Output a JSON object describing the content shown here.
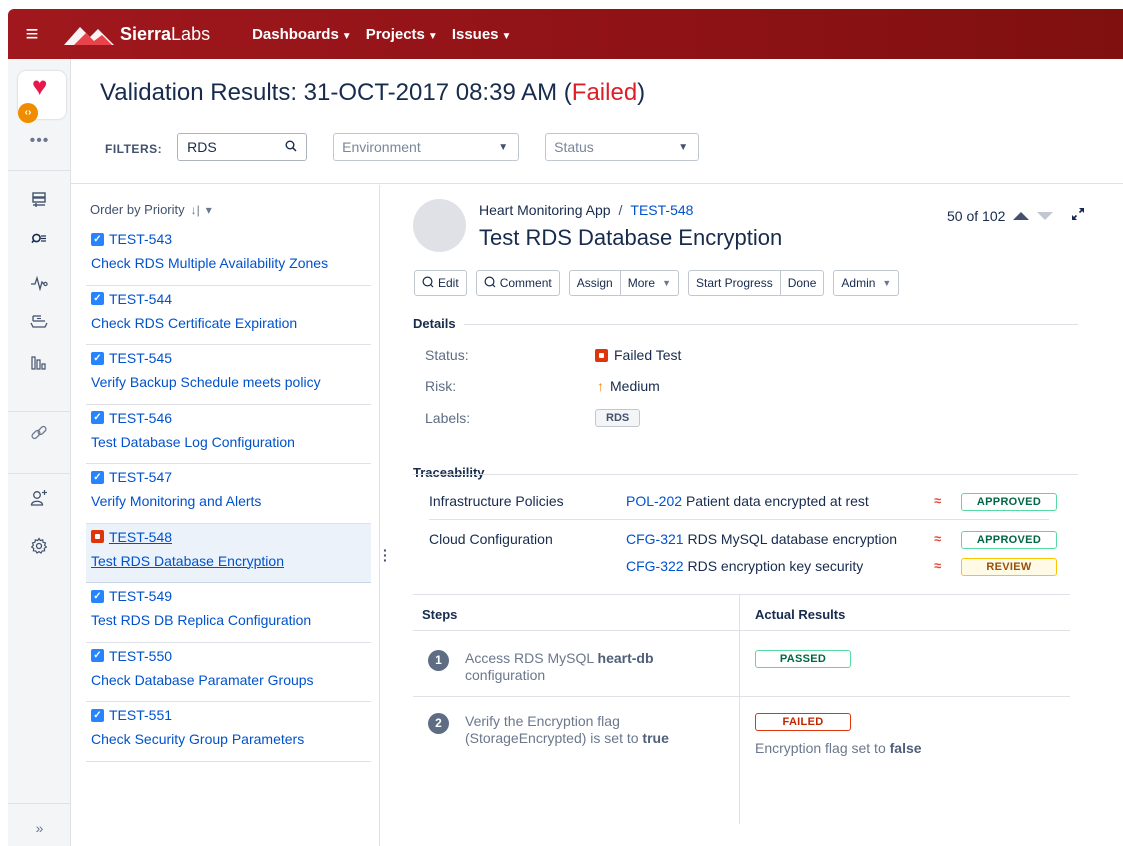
{
  "topbar": {
    "brand_bold": "Sierra",
    "brand_light": "Labs",
    "nav": [
      "Dashboards",
      "Projects",
      "Issues"
    ]
  },
  "rail": {
    "app_icon": "heart-icon",
    "more": "•••",
    "expand": "»"
  },
  "header": {
    "title_prefix": "Validation Results: 31-OCT-2017 08:39 AM (",
    "title_status": "Failed",
    "title_suffix": ")",
    "status_color": "#de1f28",
    "filters_label": "FILTERS:",
    "search_value": "RDS",
    "environment_placeholder": "Environment",
    "status_placeholder": "Status"
  },
  "list": {
    "order_label": "Order by Priority",
    "items": [
      {
        "key": "TEST-543",
        "summary": "Check RDS Multiple Availability Zones",
        "state": "pass"
      },
      {
        "key": "TEST-544",
        "summary": "Check RDS Certificate Expiration",
        "state": "pass"
      },
      {
        "key": "TEST-545",
        "summary": "Verify Backup Schedule meets policy",
        "state": "pass"
      },
      {
        "key": "TEST-546",
        "summary": "Test Database Log Configuration",
        "state": "pass"
      },
      {
        "key": "TEST-547",
        "summary": "Verify Monitoring and Alerts",
        "state": "pass"
      },
      {
        "key": "TEST-548",
        "summary": "Test RDS Database Encryption",
        "state": "fail"
      },
      {
        "key": "TEST-549",
        "summary": "Test RDS DB Replica Configuration",
        "state": "pass"
      },
      {
        "key": "TEST-550",
        "summary": "Check Database Paramater Groups",
        "state": "pass"
      },
      {
        "key": "TEST-551",
        "summary": "Check Security Group Parameters",
        "state": "pass"
      }
    ]
  },
  "issue": {
    "project": "Heart Monitoring App",
    "crumb_sep": "/",
    "key": "TEST-548",
    "title": "Test RDS Database Encryption",
    "pager": "50 of 102",
    "toolbar": {
      "edit": "Edit",
      "comment": "Comment",
      "assign": "Assign",
      "more": "More",
      "start_progress": "Start Progress",
      "done": "Done",
      "admin": "Admin"
    },
    "details": {
      "title": "Details",
      "status_label": "Status:",
      "status_value": "Failed Test",
      "risk_label": "Risk:",
      "risk_value": "Medium",
      "labels_label": "Labels:",
      "label_chip": "RDS"
    },
    "traceability": {
      "title": "Traceability",
      "groups": [
        {
          "name": "Infrastructure Policies",
          "links": [
            {
              "key": "POL-202",
              "text": "Patient data encrypted at rest",
              "badge": "APPROVED"
            }
          ]
        },
        {
          "name": "Cloud Configuration",
          "links": [
            {
              "key": "CFG-321",
              "text": "RDS MySQL database encryption",
              "badge": "APPROVED"
            },
            {
              "key": "CFG-322",
              "text": "RDS encryption key security",
              "badge": "REVIEW"
            }
          ]
        }
      ]
    },
    "steps": {
      "col_steps": "Steps",
      "col_results": "Actual Results",
      "rows": [
        {
          "num": "1",
          "line1_pre": "Access RDS MySQL ",
          "line1_bold": "heart-db",
          "line2_pre": "configuration",
          "line2_bold": "",
          "result": "PASSED",
          "note_pre": "",
          "note_bold": ""
        },
        {
          "num": "2",
          "line1_pre": "Verify the Encryption flag",
          "line1_bold": "",
          "line2_pre": "(StorageEncrypted) is set to ",
          "line2_bold": "true",
          "result": "FAILED",
          "note_pre": "Encryption flag set to ",
          "note_bold": "false"
        }
      ]
    }
  }
}
